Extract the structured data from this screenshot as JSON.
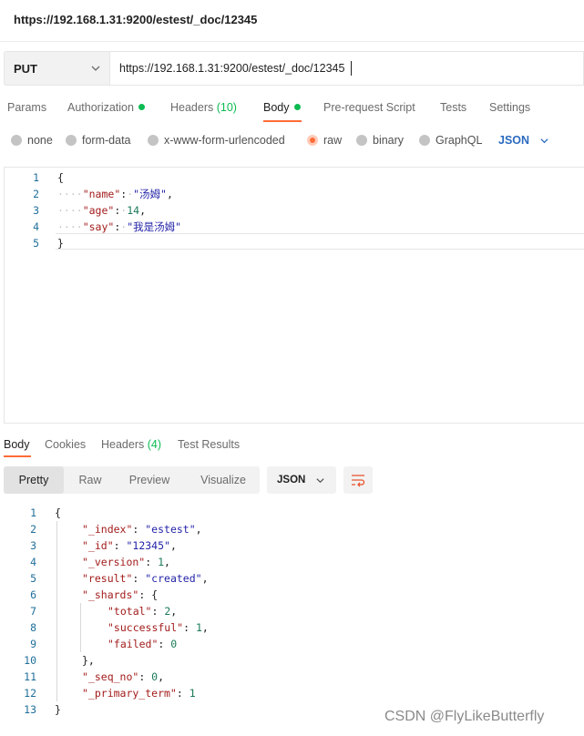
{
  "window": {
    "title": "https://192.168.1.31:9200/estest/_doc/12345"
  },
  "request": {
    "method": "PUT",
    "url": "https://192.168.1.31:9200/estest/_doc/12345"
  },
  "request_tabs": [
    {
      "label": "Params"
    },
    {
      "label": "Authorization"
    },
    {
      "label": "Headers",
      "count": "(10)"
    },
    {
      "label": "Body"
    },
    {
      "label": "Pre-request Script"
    },
    {
      "label": "Tests"
    },
    {
      "label": "Settings"
    }
  ],
  "body_types": [
    {
      "label": "none"
    },
    {
      "label": "form-data"
    },
    {
      "label": "x-www-form-urlencoded"
    },
    {
      "label": "raw"
    },
    {
      "label": "binary"
    },
    {
      "label": "GraphQL"
    }
  ],
  "body_language": "JSON",
  "request_body_lines": [
    {
      "no": "1",
      "text": "{"
    },
    {
      "no": "2",
      "indent": "····",
      "key": "\"name\"",
      "colon": ":",
      "dot": "·",
      "value": "\"汤姆\"",
      "tail": ","
    },
    {
      "no": "3",
      "indent": "····",
      "key": "\"age\"",
      "colon": ":",
      "dot": "·",
      "value": "14",
      "tail": ","
    },
    {
      "no": "4",
      "indent": "····",
      "key": "\"say\"",
      "colon": ":",
      "dot": "·",
      "value": "\"我是汤姆\"",
      "tail": ""
    },
    {
      "no": "5",
      "text": "}"
    }
  ],
  "response_tabs": [
    {
      "label": "Body"
    },
    {
      "label": "Cookies"
    },
    {
      "label": "Headers",
      "count": "(4)"
    },
    {
      "label": "Test Results"
    }
  ],
  "view_modes": [
    "Pretty",
    "Raw",
    "Preview",
    "Visualize"
  ],
  "response_format": "JSON",
  "response_lines": [
    {
      "no": "1",
      "text": "{"
    },
    {
      "no": "2",
      "key": "\"_index\"",
      "value": "\"estest\"",
      "tail": ","
    },
    {
      "no": "3",
      "key": "\"_id\"",
      "value": "\"12345\"",
      "tail": ","
    },
    {
      "no": "4",
      "key": "\"_version\"",
      "value": "1",
      "tail": ","
    },
    {
      "no": "5",
      "key": "\"result\"",
      "value": "\"created\"",
      "tail": ","
    },
    {
      "no": "6",
      "key": "\"_shards\"",
      "value": "{",
      "tail": ""
    },
    {
      "no": "7",
      "key": "\"total\"",
      "value": "2",
      "tail": ","
    },
    {
      "no": "8",
      "key": "\"successful\"",
      "value": "1",
      "tail": ","
    },
    {
      "no": "9",
      "key": "\"failed\"",
      "value": "0",
      "tail": ""
    },
    {
      "no": "10",
      "text": "},"
    },
    {
      "no": "11",
      "key": "\"_seq_no\"",
      "value": "0",
      "tail": ","
    },
    {
      "no": "12",
      "key": "\"_primary_term\"",
      "value": "1",
      "tail": ""
    },
    {
      "no": "13",
      "text": "}"
    }
  ],
  "watermark": "CSDN @FlyLikeButterfly",
  "colors": {
    "accent": "#ff6c37",
    "success": "#0cbb52",
    "link": "#2b6bbf"
  }
}
